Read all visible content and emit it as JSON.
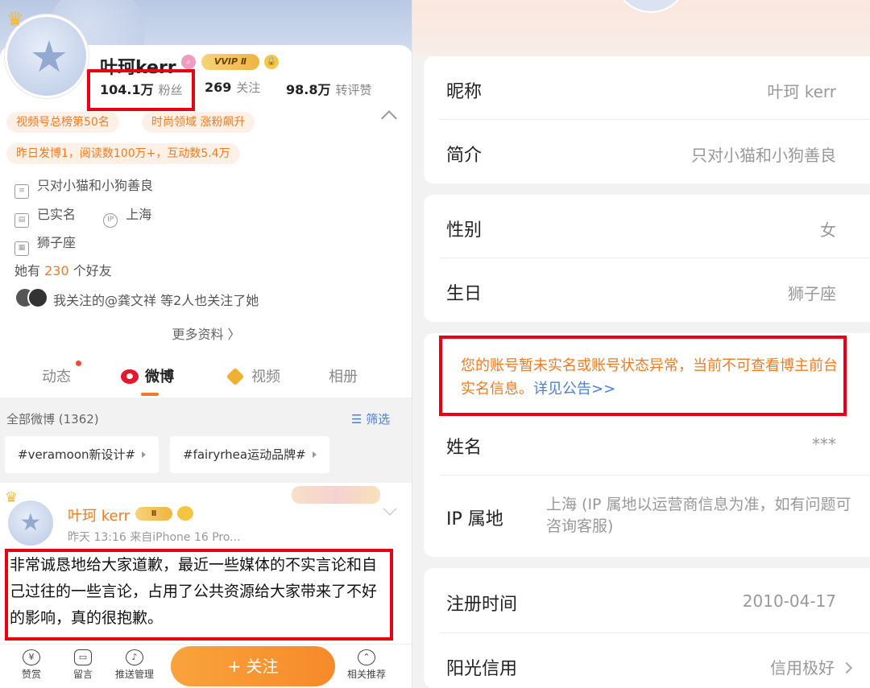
{
  "left": {
    "profile": {
      "name": "叶珂kerr",
      "vip_badge": "VVIP Ⅱ",
      "stats": [
        {
          "value": "104.1万",
          "label": "粉丝"
        },
        {
          "value": "269",
          "label": "关注"
        },
        {
          "value": "98.8万",
          "label": "转评赞"
        }
      ],
      "tags": [
        "视频号总榜第50名",
        "时尚领域 涨粉飙升"
      ],
      "tag_yesterday": "昨日发博1，阅读数100万+，互动数5.4万",
      "bio": "只对小猫和小狗善良",
      "verified": "已实名",
      "ip_icon": "IP",
      "ip": "上海",
      "zodiac": "狮子座",
      "friends_prefix": "她有",
      "friends_count": "230",
      "friends_suffix": "个好友",
      "mutual": "我关注的@龚文祥 等2人也关注了她",
      "more_info": "更多资料 〉"
    },
    "tabs": [
      {
        "label": "动态"
      },
      {
        "label": "微博"
      },
      {
        "label": "视频"
      },
      {
        "label": "相册"
      }
    ],
    "feed": {
      "all_weibo": "全部微博 (1362)",
      "filter": "☰ 筛选",
      "chips": [
        "#veramoon新设计#",
        "#fairyrhea运动品牌#"
      ]
    },
    "post": {
      "author": "叶珂 kerr",
      "badge": "Ⅱ",
      "meta": "昨天 13:16  来自iPhone 16 Pro...",
      "text": "非常诚恳地给大家道歉，最近一些媒体的不实言论和自己过往的一些言论，占用了公共资源给大家带来了不好的影响，真的很抱歉。"
    },
    "bottom_bar": {
      "reward": "赞赏",
      "message": "留言",
      "push": "推送管理",
      "follow": "+ 关注",
      "related": "相关推荐"
    }
  },
  "right": {
    "nickname_label": "昵称",
    "nickname_value": "叶珂 kerr",
    "intro_label": "简介",
    "intro_value": "只对小猫和小狗善良",
    "gender_label": "性别",
    "gender_value": "女",
    "birthday_label": "生日",
    "birthday_value": "狮子座",
    "notice_text": "您的账号暂未实名或账号状态异常，当前不可查看博主前台实名信息。",
    "notice_link": "详见公告>>",
    "realname_label": "姓名",
    "realname_value": "***",
    "ip_label": "IP 属地",
    "ip_value": "上海 (IP 属地以运营商信息为准，如有问题可咨询客服)",
    "register_label": "注册时间",
    "register_value": "2010-04-17",
    "credit_label": "阳光信用",
    "credit_value": "信用极好"
  },
  "colors": {
    "accent_orange": "#f07b22",
    "highlight_red": "#e60012",
    "link_blue": "#4a7fd8"
  }
}
